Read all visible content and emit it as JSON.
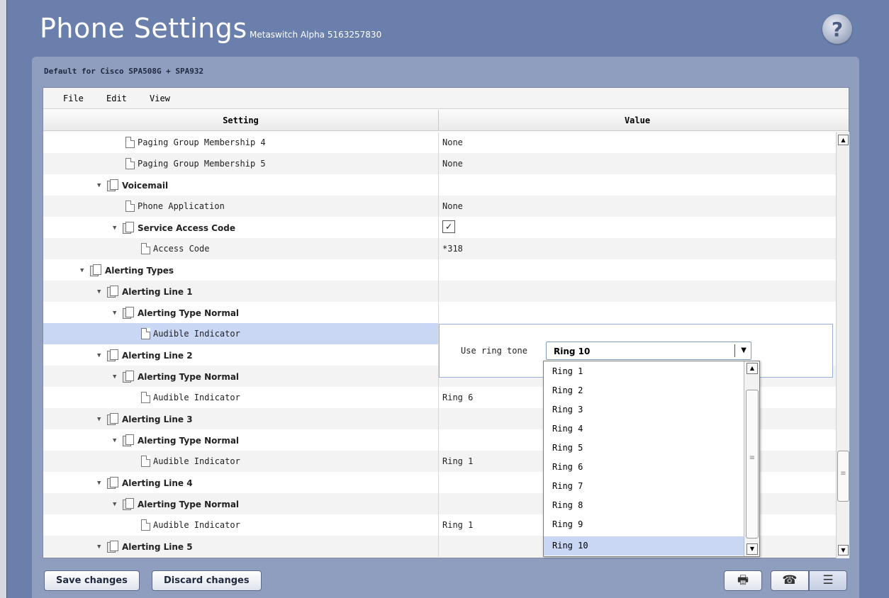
{
  "header": {
    "title": "Phone Settings",
    "subtitle": "Metaswitch Alpha 5163257830",
    "help_label": "?"
  },
  "panel": {
    "title": "Default for Cisco SPA508G + SPA932"
  },
  "menu": [
    "File",
    "Edit",
    "View"
  ],
  "columns": {
    "setting": "Setting",
    "value": "Value"
  },
  "rows": [
    {
      "label": "Paging Group Membership 4",
      "value": "None"
    },
    {
      "label": "Paging Group Membership 5",
      "value": "None"
    },
    {
      "label": "Voicemail",
      "value": ""
    },
    {
      "label": "Phone Application",
      "value": "None"
    },
    {
      "label": "Service Access Code",
      "value": "",
      "checked": true
    },
    {
      "label": "Access Code",
      "value": "*318"
    },
    {
      "label": "Alerting Types",
      "value": ""
    },
    {
      "label": "Alerting Line 1",
      "value": ""
    },
    {
      "label": "Alerting Type Normal",
      "value": ""
    },
    {
      "label": "Audible Indicator",
      "value": ""
    },
    {
      "label": "Alerting Line 2",
      "value": ""
    },
    {
      "label": "Alerting Type Normal",
      "value": ""
    },
    {
      "label": "Audible Indicator",
      "value": "Ring 6"
    },
    {
      "label": "Alerting Line 3",
      "value": ""
    },
    {
      "label": "Alerting Type Normal",
      "value": ""
    },
    {
      "label": "Audible Indicator",
      "value": "Ring 1"
    },
    {
      "label": "Alerting Line 4",
      "value": ""
    },
    {
      "label": "Alerting Type Normal",
      "value": ""
    },
    {
      "label": "Audible Indicator",
      "value": "Ring 1"
    },
    {
      "label": "Alerting Line 5",
      "value": ""
    }
  ],
  "editor": {
    "label": "Use ring tone",
    "selected": "Ring 10",
    "options": [
      "Ring 1",
      "Ring 2",
      "Ring 3",
      "Ring 4",
      "Ring 5",
      "Ring 6",
      "Ring 7",
      "Ring 8",
      "Ring 9",
      "Ring 10"
    ]
  },
  "buttons": {
    "save": "Save changes",
    "discard": "Discard changes"
  },
  "icons": {
    "checkmark": "✓",
    "expanded": "▼",
    "up_arrow": "▲",
    "down_arrow": "▼",
    "grip": "≡",
    "print": "🖶",
    "phone": "☎",
    "list": "☰"
  },
  "colors": {
    "background": "#6a7fab",
    "panel": "#8f9dbf",
    "selection": "#c9d6f4"
  }
}
